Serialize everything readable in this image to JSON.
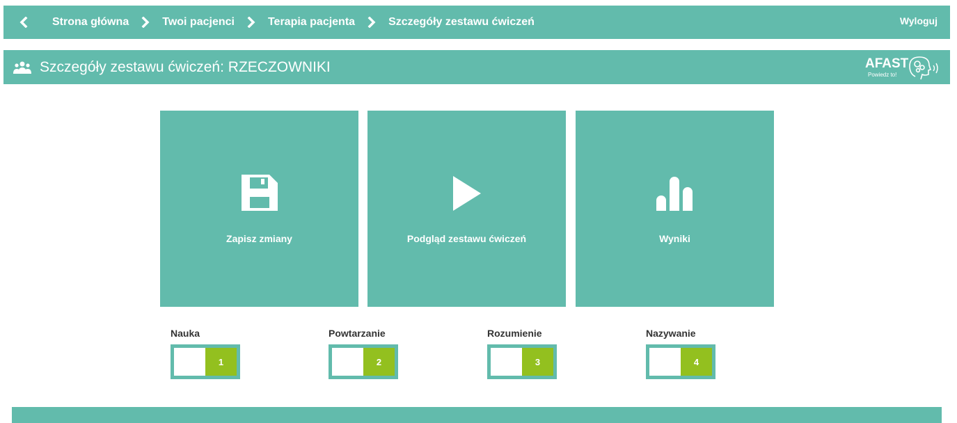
{
  "nav": {
    "breadcrumbs": [
      "Strona główna",
      "Twoi pacjenci",
      "Terapia pacjenta",
      "Szczegóły zestawu ćwiczeń"
    ],
    "logout": "Wyloguj"
  },
  "header": {
    "title": "Szczegóły zestawu ćwiczeń: RZECZOWNIKI",
    "logo_text": "AFAST",
    "logo_tagline": "Powiedz to!"
  },
  "tiles": [
    {
      "label": "Zapisz zmiany",
      "icon": "save-icon"
    },
    {
      "label": "Podgląd zestawu ćwiczeń",
      "icon": "play-icon"
    },
    {
      "label": "Wyniki",
      "icon": "bar-chart-icon"
    }
  ],
  "modes": [
    {
      "label": "Nauka",
      "value": "1"
    },
    {
      "label": "Powtarzanie",
      "value": "2"
    },
    {
      "label": "Rozumienie",
      "value": "3"
    },
    {
      "label": "Nazywanie",
      "value": "4"
    }
  ],
  "colors": {
    "accent": "#62bbac",
    "active": "#93c01f"
  }
}
